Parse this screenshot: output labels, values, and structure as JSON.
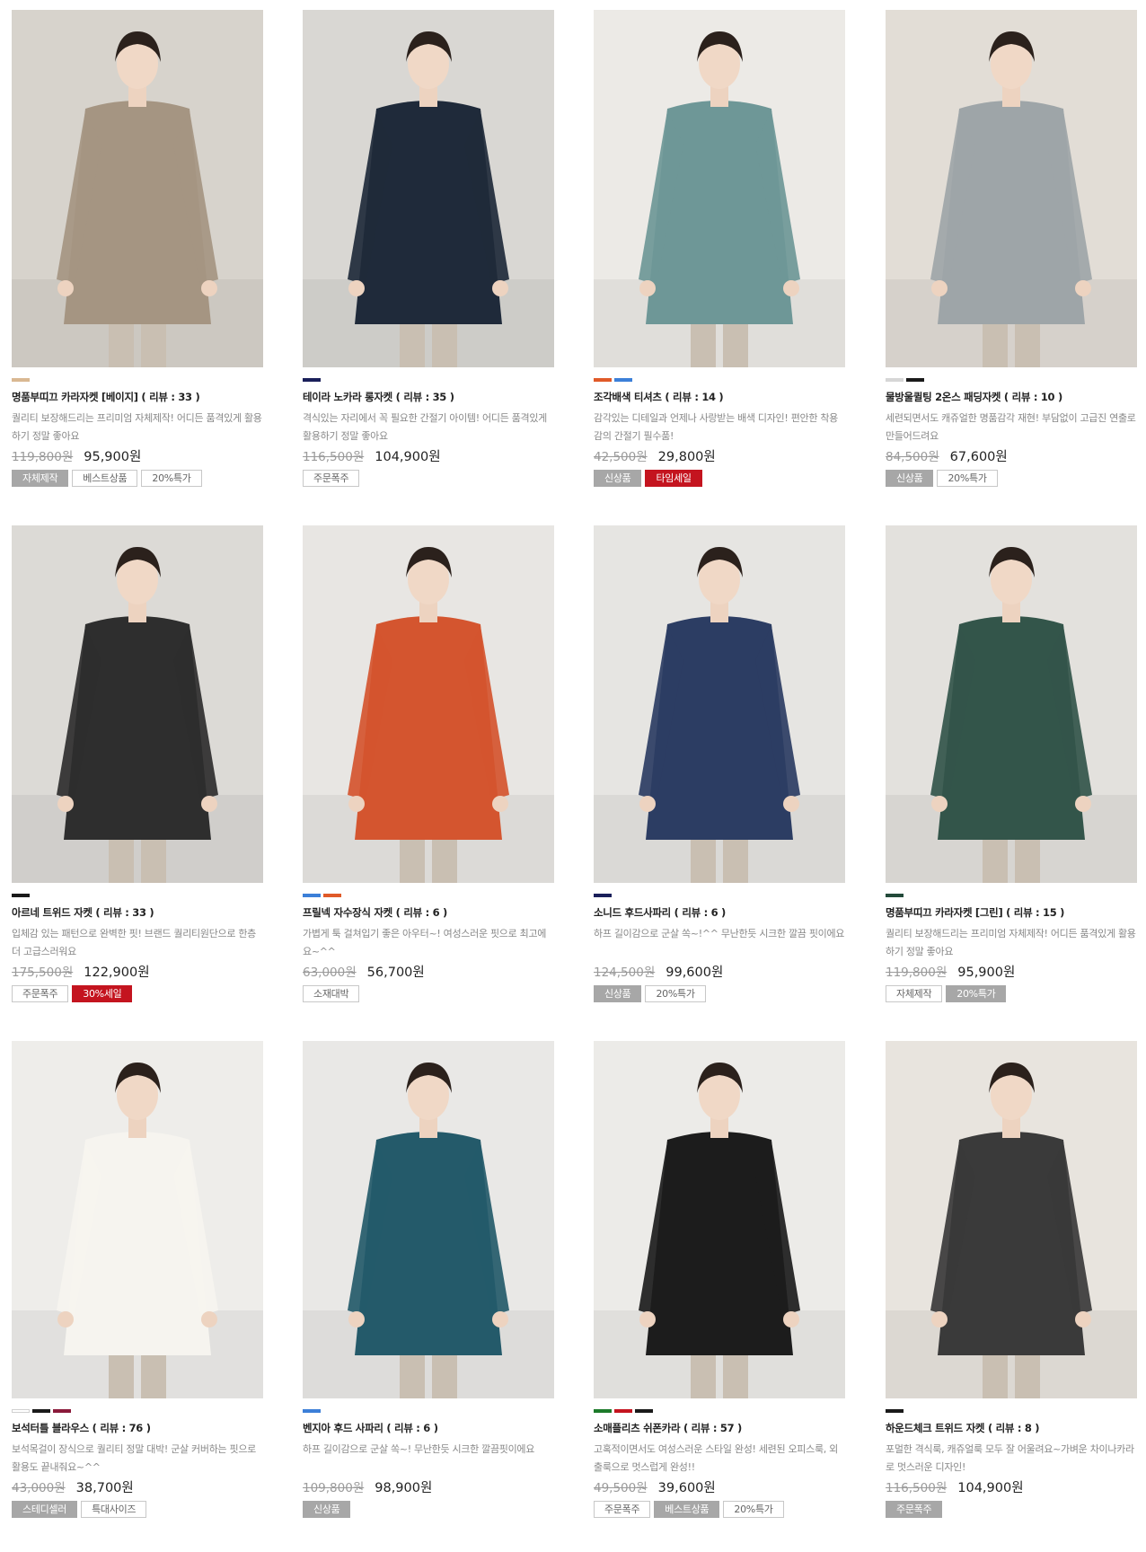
{
  "products": [
    {
      "title": "명품부띠끄 카라자켓 [베이지]",
      "review": "( 리뷰 : 33 )",
      "desc": "퀄리티 보장해드리는 프리미엄 자체제작! 어디든 품격있게 활용하기 정말 좋아요",
      "orig": "119,800원",
      "sale": "95,900원",
      "swatches": [
        "#d9b892"
      ],
      "tags": [
        {
          "label": "자체제작",
          "style": "gray"
        },
        {
          "label": "베스트상품",
          "style": "outline"
        },
        {
          "label": "20%특가",
          "style": "outline"
        }
      ],
      "photo": {
        "bg": "#d7d3cc",
        "garment": "#a59582",
        "icon": "coat-photo-icon"
      }
    },
    {
      "title": "테이라 노카라 롱자켓",
      "review": "( 리뷰 : 35 )",
      "desc": "격식있는 자리에서 꼭 필요한 간절기 아이템! 어디든 품격있게 활용하기 정말 좋아요",
      "orig": "116,500원",
      "sale": "104,900원",
      "swatches": [
        "#1a1f5a"
      ],
      "tags": [
        {
          "label": "주문폭주",
          "style": "outline"
        }
      ],
      "photo": {
        "bg": "#d9d7d3",
        "garment": "#1f2a3a",
        "icon": "coat-photo-icon"
      }
    },
    {
      "title": "조각배색 티셔츠",
      "review": "( 리뷰 : 14 )",
      "desc": "감각있는 디테일과 언제나 사랑받는 배색 디자인! 편안한 착용감의 간절기 필수품!",
      "orig": "42,500원",
      "sale": "29,800원",
      "swatches": [
        "#e05a28",
        "#3c7fd8"
      ],
      "tags": [
        {
          "label": "신상품",
          "style": "gray"
        },
        {
          "label": "타임세일",
          "style": "red"
        }
      ],
      "photo": {
        "bg": "#eceae6",
        "garment": "#6e9797",
        "icon": "tshirt-photo-icon"
      }
    },
    {
      "title": "물방울퀼팅 2온스 패딩자켓",
      "review": "( 리뷰 : 10 )",
      "desc": "세련되면서도 캐쥬얼한 명품감각 재현! 부담없이 고급진 연출로 만들어드려요",
      "orig": "84,500원",
      "sale": "67,600원",
      "swatches": [
        "#d6d6d6",
        "#1a1a1a"
      ],
      "tags": [
        {
          "label": "신상품",
          "style": "gray"
        },
        {
          "label": "20%특가",
          "style": "outline"
        }
      ],
      "photo": {
        "bg": "#e2ddd6",
        "garment": "#9ea5a8",
        "icon": "jacket-photo-icon"
      }
    },
    {
      "title": "아르네 트위드 자켓",
      "review": "( 리뷰 : 33 )",
      "desc": "입체감 있는 패턴으로 완벽한 핏! 브랜드 퀄리티원단으로 한층 더 고급스러워요",
      "orig": "175,500원",
      "sale": "122,900원",
      "swatches": [
        "#1a1a1a"
      ],
      "tags": [
        {
          "label": "주문폭주",
          "style": "outline"
        },
        {
          "label": "30%세일",
          "style": "red"
        }
      ],
      "photo": {
        "bg": "#dcdad6",
        "garment": "#2e2e2e",
        "icon": "jacket-photo-icon"
      }
    },
    {
      "title": "프릴넥 자수장식 자켓",
      "review": "( 리뷰 : 6 )",
      "desc": "가볍게 툭 걸쳐입기 좋은 아우터~! 여성스러운 핏으로 최고에요~^^",
      "orig": "63,000원",
      "sale": "56,700원",
      "swatches": [
        "#3c7fd8",
        "#e05a28"
      ],
      "tags": [
        {
          "label": "소재대박",
          "style": "outline"
        }
      ],
      "photo": {
        "bg": "#e8e6e3",
        "garment": "#d4552f",
        "icon": "jacket-photo-icon"
      }
    },
    {
      "title": "소니드 후드사파리",
      "review": "( 리뷰 : 6 )",
      "desc": "하프 길이감으로 군살 쏙~!^^ 무난한듯 시크한 깔끔 핏이에요",
      "orig": "124,500원",
      "sale": "99,600원",
      "swatches": [
        "#1a1f5a"
      ],
      "tags": [
        {
          "label": "신상품",
          "style": "gray"
        },
        {
          "label": "20%특가",
          "style": "outline"
        }
      ],
      "photo": {
        "bg": "#e6e5e2",
        "garment": "#2c3d63",
        "icon": "safari-photo-icon"
      }
    },
    {
      "title": "명품부띠끄 카라자켓 [그린]",
      "review": "( 리뷰 : 15 )",
      "desc": "퀄리티 보장해드리는 프리미엄 자체제작! 어디든 품격있게 활용하기 정말 좋아요",
      "orig": "119,800원",
      "sale": "95,900원",
      "swatches": [
        "#234a3a"
      ],
      "tags": [
        {
          "label": "자체제작",
          "style": "outline"
        },
        {
          "label": "20%특가",
          "style": "gray"
        }
      ],
      "photo": {
        "bg": "#e3e1dd",
        "garment": "#33554a",
        "icon": "coat-photo-icon"
      }
    },
    {
      "title": "보석터틀 블라우스",
      "review": "( 리뷰 : 76 )",
      "desc": "보석목걸이 장식으로 퀄리티 정말 대박! 군살 커버하는 핏으로 활용도 끝내줘요~^^",
      "orig": "43,000원",
      "sale": "38,700원",
      "swatches": [
        "#ffffff",
        "#1a1a1a",
        "#8a1a3a"
      ],
      "tags": [
        {
          "label": "스테디셀러",
          "style": "gray"
        },
        {
          "label": "특대사이즈",
          "style": "outline"
        }
      ],
      "photo": {
        "bg": "#eeedea",
        "garment": "#f6f4ef",
        "icon": "blouse-photo-icon"
      }
    },
    {
      "title": "벤지아 후드 사파리",
      "review": "( 리뷰 : 6 )",
      "desc": "하프 길이감으로 군살 쏙~! 무난한듯 시크한 깔끔핏이에요",
      "orig": "109,800원",
      "sale": "98,900원",
      "swatches": [
        "#3c7fd8"
      ],
      "tags": [
        {
          "label": "신상품",
          "style": "gray"
        }
      ],
      "photo": {
        "bg": "#e9e8e6",
        "garment": "#245a6a",
        "icon": "safari-photo-icon"
      }
    },
    {
      "title": "소매플리츠 쉬폰카라",
      "review": "( 리뷰 : 57 )",
      "desc": "고혹적이면서도 여성스러운 스타일 완성! 세련된 오피스룩, 외출룩으로 멋스럽게 완성!!",
      "orig": "49,500원",
      "sale": "39,600원",
      "swatches": [
        "#1c7a2a",
        "#c4141f",
        "#1a1a1a"
      ],
      "tags": [
        {
          "label": "주문폭주",
          "style": "outline"
        },
        {
          "label": "베스트상품",
          "style": "gray"
        },
        {
          "label": "20%특가",
          "style": "outline"
        }
      ],
      "photo": {
        "bg": "#ecebe8",
        "garment": "#1c1c1c",
        "icon": "blouse-photo-icon"
      }
    },
    {
      "title": "하운드체크 트위드 자켓",
      "review": "( 리뷰 : 8 )",
      "desc": "포멀한 격식룩, 캐쥬얼룩 모두 잘 어울려요~가벼운 차이나카라로 멋스러운 디자인!",
      "orig": "116,500원",
      "sale": "104,900원",
      "swatches": [
        "#1a1a1a"
      ],
      "tags": [
        {
          "label": "주문폭주",
          "style": "gray"
        }
      ],
      "photo": {
        "bg": "#e8e4de",
        "garment": "#3a3a3a",
        "icon": "jacket-photo-icon"
      }
    }
  ]
}
